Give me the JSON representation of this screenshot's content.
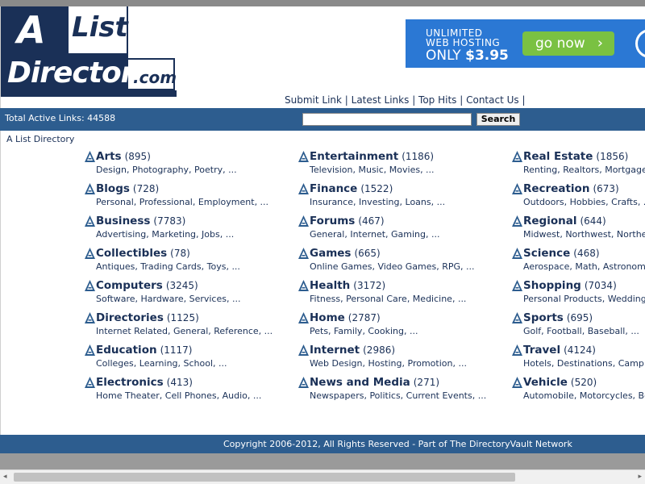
{
  "logo": {
    "a": "A",
    "list": "List",
    "directory": "Directory",
    "com": ".com"
  },
  "ad": {
    "line1": "UNLIMITED",
    "line2": "WEB HOSTING",
    "line3a": "ONLY ",
    "price": "$3.95",
    "button": "go now",
    "chevron": "›"
  },
  "nav": {
    "submit": "Submit Link",
    "latest": "Latest Links",
    "tophits": "Top Hits",
    "contact": "Contact Us",
    "sep": " | "
  },
  "stats": {
    "total": "Total Active Links: 44588"
  },
  "search": {
    "button": "Search",
    "value": ""
  },
  "breadcrumb": "A List Directory",
  "columns": [
    [
      {
        "name": "Arts",
        "count": "(895)",
        "subs": "Design, Photography, Poetry, ..."
      },
      {
        "name": "Blogs",
        "count": "(728)",
        "subs": "Personal, Professional, Employment, ..."
      },
      {
        "name": "Business",
        "count": "(7783)",
        "subs": "Advertising, Marketing, Jobs, ..."
      },
      {
        "name": "Collectibles",
        "count": "(78)",
        "subs": "Antiques, Trading Cards, Toys, ..."
      },
      {
        "name": "Computers",
        "count": "(3245)",
        "subs": "Software, Hardware, Services, ..."
      },
      {
        "name": "Directories",
        "count": "(1125)",
        "subs": "Internet Related, General, Reference, ..."
      },
      {
        "name": "Education",
        "count": "(1117)",
        "subs": "Colleges, Learning, School, ..."
      },
      {
        "name": "Electronics",
        "count": "(413)",
        "subs": "Home Theater, Cell Phones, Audio, ..."
      }
    ],
    [
      {
        "name": "Entertainment",
        "count": "(1186)",
        "subs": "Television, Music, Movies, ..."
      },
      {
        "name": "Finance",
        "count": "(1522)",
        "subs": "Insurance, Investing, Loans, ..."
      },
      {
        "name": "Forums",
        "count": "(467)",
        "subs": "General, Internet, Gaming, ..."
      },
      {
        "name": "Games",
        "count": "(665)",
        "subs": "Online Games, Video Games, RPG, ..."
      },
      {
        "name": "Health",
        "count": "(3172)",
        "subs": "Fitness, Personal Care, Medicine, ..."
      },
      {
        "name": "Home",
        "count": "(2787)",
        "subs": "Pets, Family, Cooking, ..."
      },
      {
        "name": "Internet",
        "count": "(2986)",
        "subs": "Web Design, Hosting, Promotion, ..."
      },
      {
        "name": "News and Media",
        "count": "(271)",
        "subs": "Newspapers, Politics, Current Events, ..."
      }
    ],
    [
      {
        "name": "Real Estate",
        "count": "(1856)",
        "subs": "Renting, Realtors, Mortgage"
      },
      {
        "name": "Recreation",
        "count": "(673)",
        "subs": "Outdoors, Hobbies, Crafts, ..."
      },
      {
        "name": "Regional",
        "count": "(644)",
        "subs": "Midwest, Northwest, Northe"
      },
      {
        "name": "Science",
        "count": "(468)",
        "subs": "Aerospace, Math, Astronom"
      },
      {
        "name": "Shopping",
        "count": "(7034)",
        "subs": "Personal Products, Wedding"
      },
      {
        "name": "Sports",
        "count": "(695)",
        "subs": "Golf, Football, Baseball, ..."
      },
      {
        "name": "Travel",
        "count": "(4124)",
        "subs": "Hotels, Destinations, Camp"
      },
      {
        "name": "Vehicle",
        "count": "(520)",
        "subs": "Automobile, Motorcycles, Bo"
      }
    ]
  ],
  "footer": "Copyright 2006-2012, All Rights Reserved - Part of The DirectoryVault Network",
  "scroll": {
    "left": "◂",
    "right": "▸"
  }
}
